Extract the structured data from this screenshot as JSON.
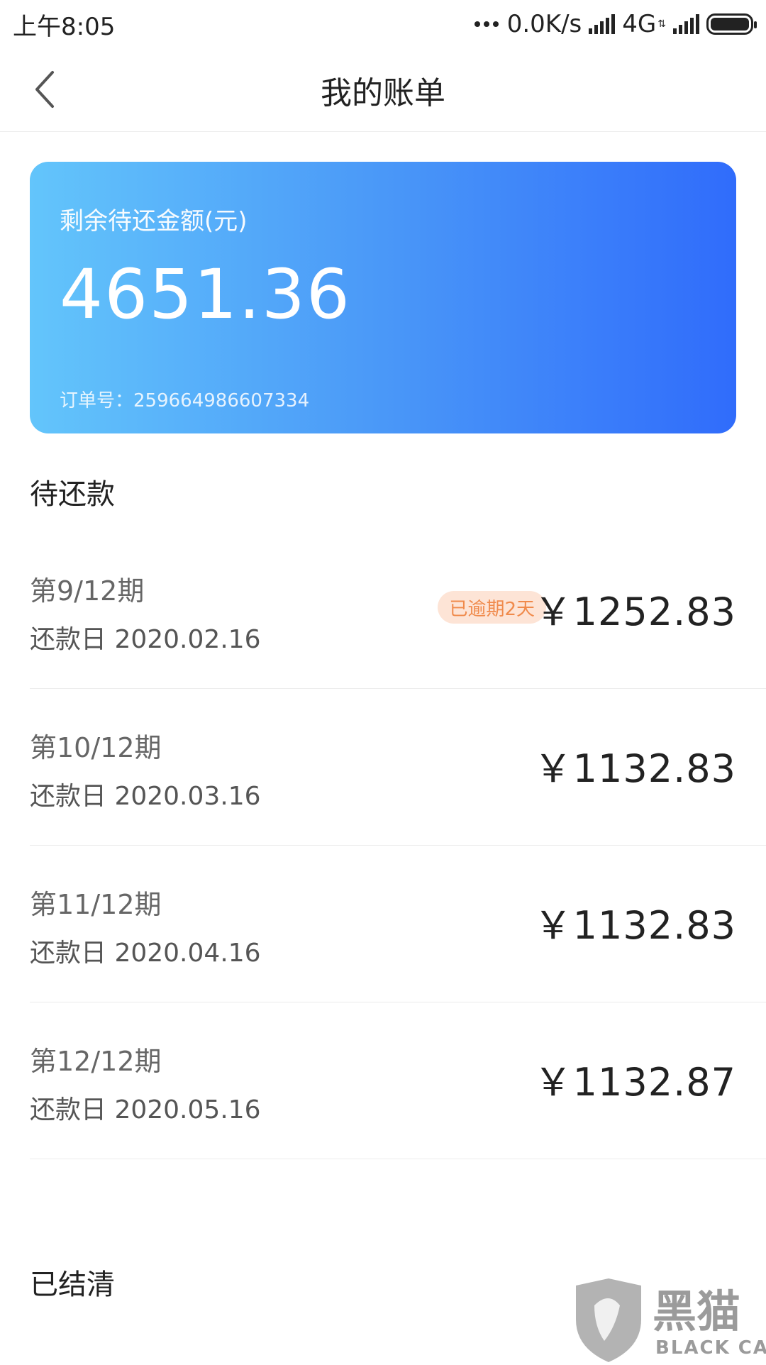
{
  "status_bar": {
    "time": "上午8:05",
    "speed": "0.0K/s",
    "network": "4G"
  },
  "header": {
    "title": "我的账单"
  },
  "balance_card": {
    "label": "剩余待还金额(元)",
    "amount": "4651.36",
    "order_number": "订单号：259664986607334"
  },
  "pending_section": {
    "title": "待还款",
    "items": [
      {
        "period": "第9/12期",
        "due_date": "还款日 2020.02.16",
        "amount": "￥1252.83",
        "badge": "已逾期2天"
      },
      {
        "period": "第10/12期",
        "due_date": "还款日 2020.03.16",
        "amount": "￥1132.83"
      },
      {
        "period": "第11/12期",
        "due_date": "还款日 2020.04.16",
        "amount": "￥1132.83"
      },
      {
        "period": "第12/12期",
        "due_date": "还款日 2020.05.16",
        "amount": "￥1132.87"
      }
    ]
  },
  "settled_section": {
    "title": "已结清"
  },
  "watermark": {
    "brand": "黑猫",
    "brand_en": "BLACK CAT"
  },
  "colors": {
    "card_start": "#63c5fb",
    "card_end": "#306cfb",
    "badge_bg": "#fde4d6",
    "badge_text": "#f08a4b"
  }
}
